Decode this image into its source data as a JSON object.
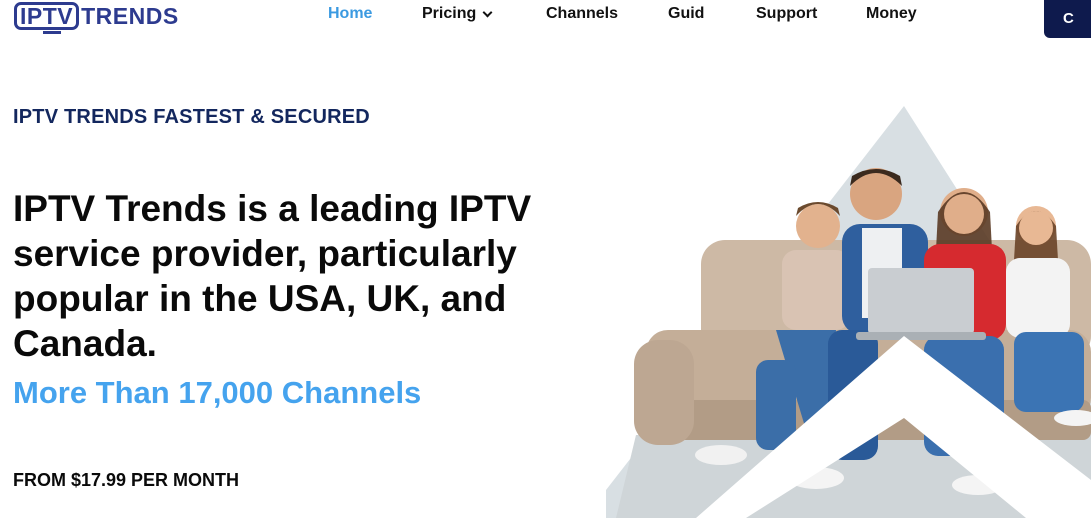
{
  "header": {
    "logo": {
      "boxed": "IPTV",
      "rest": "TRENDS"
    },
    "nav": [
      {
        "label": "Home",
        "active": true
      },
      {
        "label": "Pricing",
        "has_dropdown": true
      },
      {
        "label": "Channels"
      },
      {
        "label": "Guid"
      },
      {
        "label": "Support"
      },
      {
        "label": "Money"
      }
    ],
    "cta_label": "C"
  },
  "hero": {
    "eyebrow": "IPTV TRENDS FASTEST & SECURED",
    "headline": "IPTV Trends is a leading IPTV service provider, particularly popular in the USA, UK, and Canada.",
    "channels": "More Than 17,000 Channels",
    "price": "FROM $17.99 PER MONTH",
    "image": "family-on-sofa-with-laptop"
  },
  "colors": {
    "brand_navy": "#2d3b8f",
    "nav_active": "#3b9ae1",
    "eyebrow": "#13275e",
    "channels_blue": "#45a3ee",
    "cta_bg": "#0e1a4d"
  }
}
